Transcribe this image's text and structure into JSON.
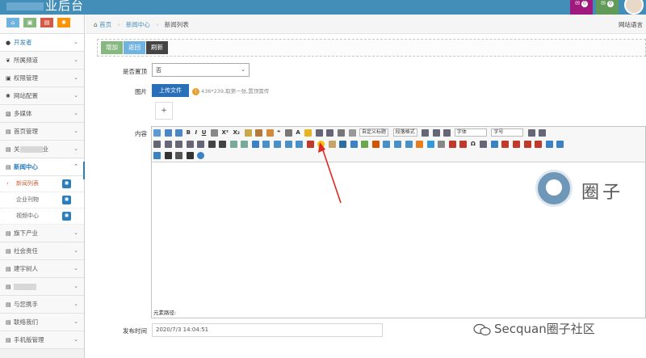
{
  "topbar": {
    "brand": "业后台",
    "badge1": "0",
    "badge2": "0",
    "colors": {
      "bar": "#438eb9"
    }
  },
  "sidebar": {
    "shortcuts": [
      {
        "icon": "home-icon",
        "color": "#6fb3e0"
      },
      {
        "icon": "lock-icon",
        "color": "#87b87f"
      },
      {
        "icon": "image-icon",
        "color": "#d15b47"
      },
      {
        "icon": "gear-icon",
        "color": "#f89406"
      }
    ],
    "items": [
      {
        "label": "开发者",
        "icon": "user-icon"
      },
      {
        "label": "所属频道",
        "icon": "leaf-icon"
      },
      {
        "label": "权限管理",
        "icon": "lock-icon"
      },
      {
        "label": "网站配置",
        "icon": "cog-icon"
      },
      {
        "label": "多媒体",
        "icon": "picture-icon"
      },
      {
        "label": "首页管理",
        "icon": "list-icon"
      },
      {
        "label_prefix": "关",
        "label_suffix": "业",
        "icon": "list-icon"
      },
      {
        "label": "新闻中心",
        "icon": "list-icon"
      },
      {
        "label": "旗下产业",
        "icon": "list-icon"
      },
      {
        "label": "社会责任",
        "icon": "list-icon"
      },
      {
        "label": "建宇树人",
        "icon": "list-icon"
      },
      {
        "label": "",
        "icon": "list-icon"
      },
      {
        "label": "与您携手",
        "icon": "list-icon"
      },
      {
        "label": "联络我们",
        "icon": "list-icon"
      },
      {
        "label": "手机版管理",
        "icon": "list-icon"
      }
    ],
    "subitems": [
      {
        "label": "新闻列表"
      },
      {
        "label": "企业刊物"
      },
      {
        "label": "视频中心"
      }
    ]
  },
  "breadcrumb": {
    "home": "首页",
    "section": "新闻中心",
    "current": "新闻列表",
    "right": "网站语言"
  },
  "buttons": {
    "add": "增加",
    "back": "返回",
    "refresh": "刷新"
  },
  "form": {
    "top_label": "是否置顶",
    "top_value": "否",
    "image_label": "图片",
    "upload_label": "上传文件",
    "upload_hint": "436*239,取第一张,置顶需传",
    "content_label": "内容",
    "element_path": "元素路径:",
    "date_label": "发布时间",
    "date_value": "2020/7/3 14:04:51"
  },
  "editor": {
    "para_format": "自定义标题",
    "para_style": "段落格式",
    "font_family": "字体",
    "font_size": "字号"
  },
  "watermark": {
    "title": "圈子",
    "bottom": "Secquan圈子社区"
  }
}
